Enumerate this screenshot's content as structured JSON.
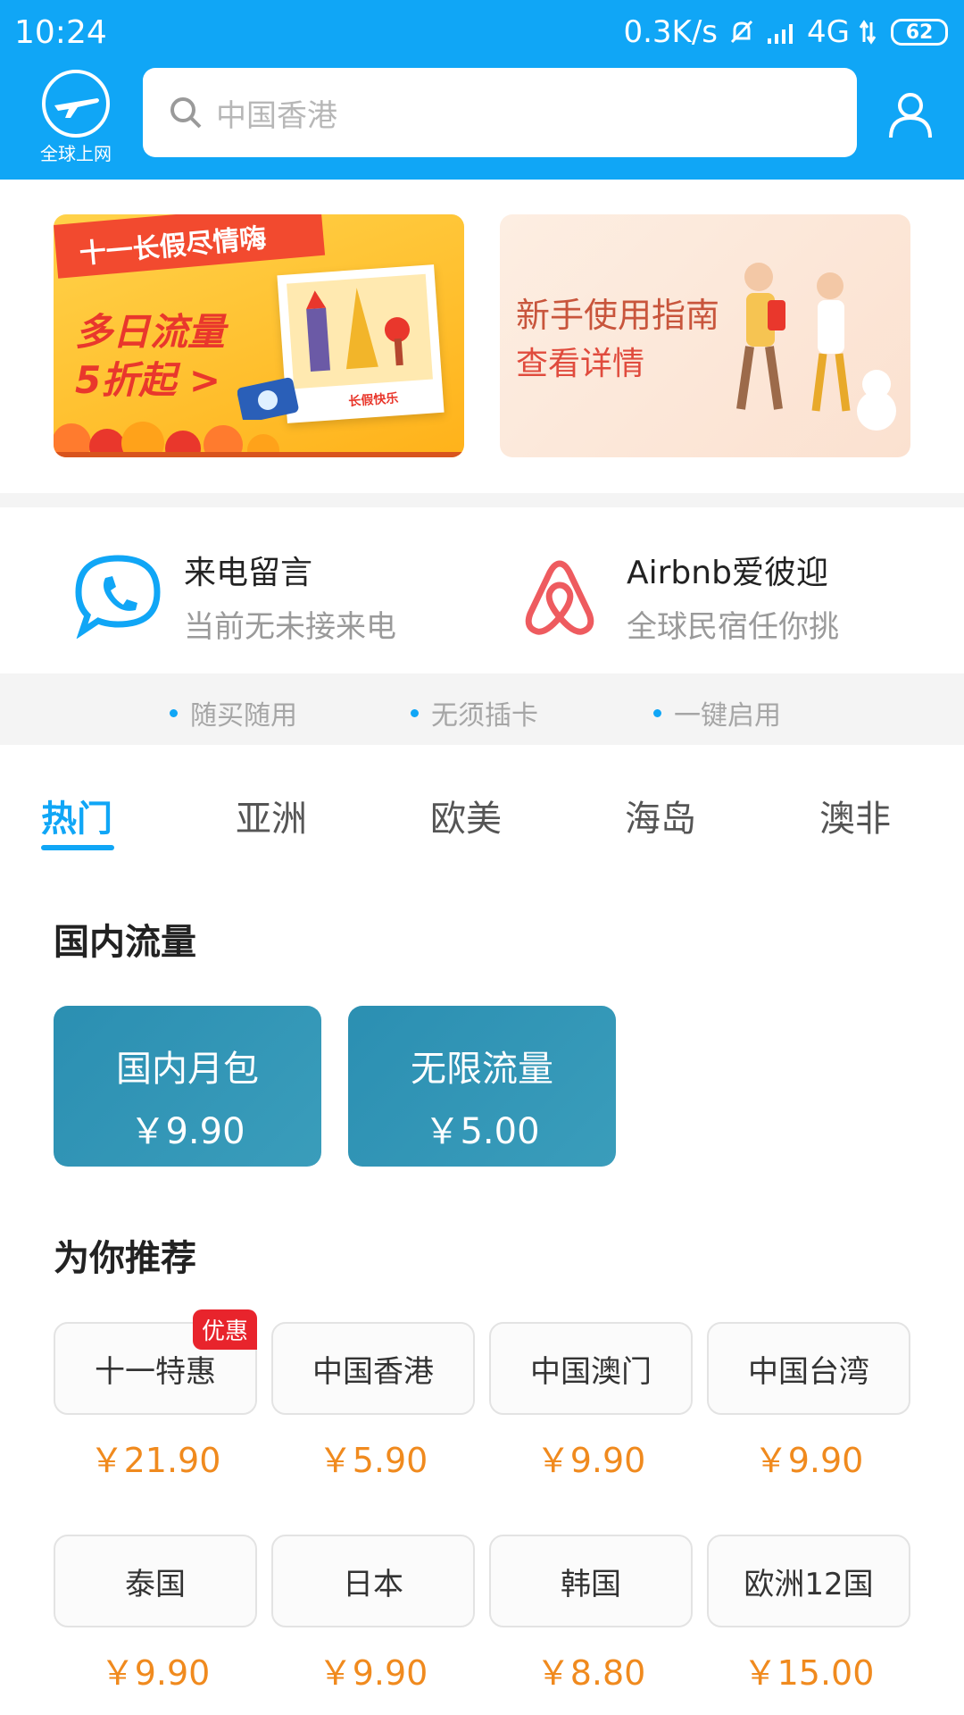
{
  "status": {
    "time": "10:24",
    "net_speed": "0.3K/s",
    "network": "4G",
    "battery": "62"
  },
  "header": {
    "logo_label": "全球上网",
    "search_placeholder": "中国香港"
  },
  "banners": {
    "left": {
      "ribbon": "十一长假尽情嗨",
      "line1": "多日流量",
      "line2": "5折起 >",
      "photo_caption": "长假快乐"
    },
    "right": {
      "title": "新手使用指南",
      "link": "查看详情"
    }
  },
  "services": [
    {
      "title": "来电留言",
      "subtitle": "当前无未接来电"
    },
    {
      "title": "Airbnb爱彼迎",
      "subtitle": "全球民宿任你挑"
    }
  ],
  "features": [
    "随买随用",
    "无须插卡",
    "一键启用"
  ],
  "tabs": [
    "热门",
    "亚洲",
    "欧美",
    "海岛",
    "澳非"
  ],
  "domestic": {
    "title": "国内流量",
    "packages": [
      {
        "name": "国内月包",
        "price": "￥9.90"
      },
      {
        "name": "无限流量",
        "price": "￥5.00"
      }
    ]
  },
  "recommend": {
    "title": "为你推荐",
    "badge": "优惠",
    "items": [
      {
        "name": "十一特惠",
        "price": "￥21.90"
      },
      {
        "name": "中国香港",
        "price": "￥5.90"
      },
      {
        "name": "中国澳门",
        "price": "￥9.90"
      },
      {
        "name": "中国台湾",
        "price": "￥9.90"
      },
      {
        "name": "泰国",
        "price": "￥9.90"
      },
      {
        "name": "日本",
        "price": "￥9.90"
      },
      {
        "name": "韩国",
        "price": "￥8.80"
      },
      {
        "name": "欧洲12国",
        "price": "￥15.00"
      }
    ]
  },
  "colors": {
    "primary": "#10a6f6",
    "price": "#f08a1e",
    "badge": "#e8242c",
    "package": "#2b8fb2"
  }
}
